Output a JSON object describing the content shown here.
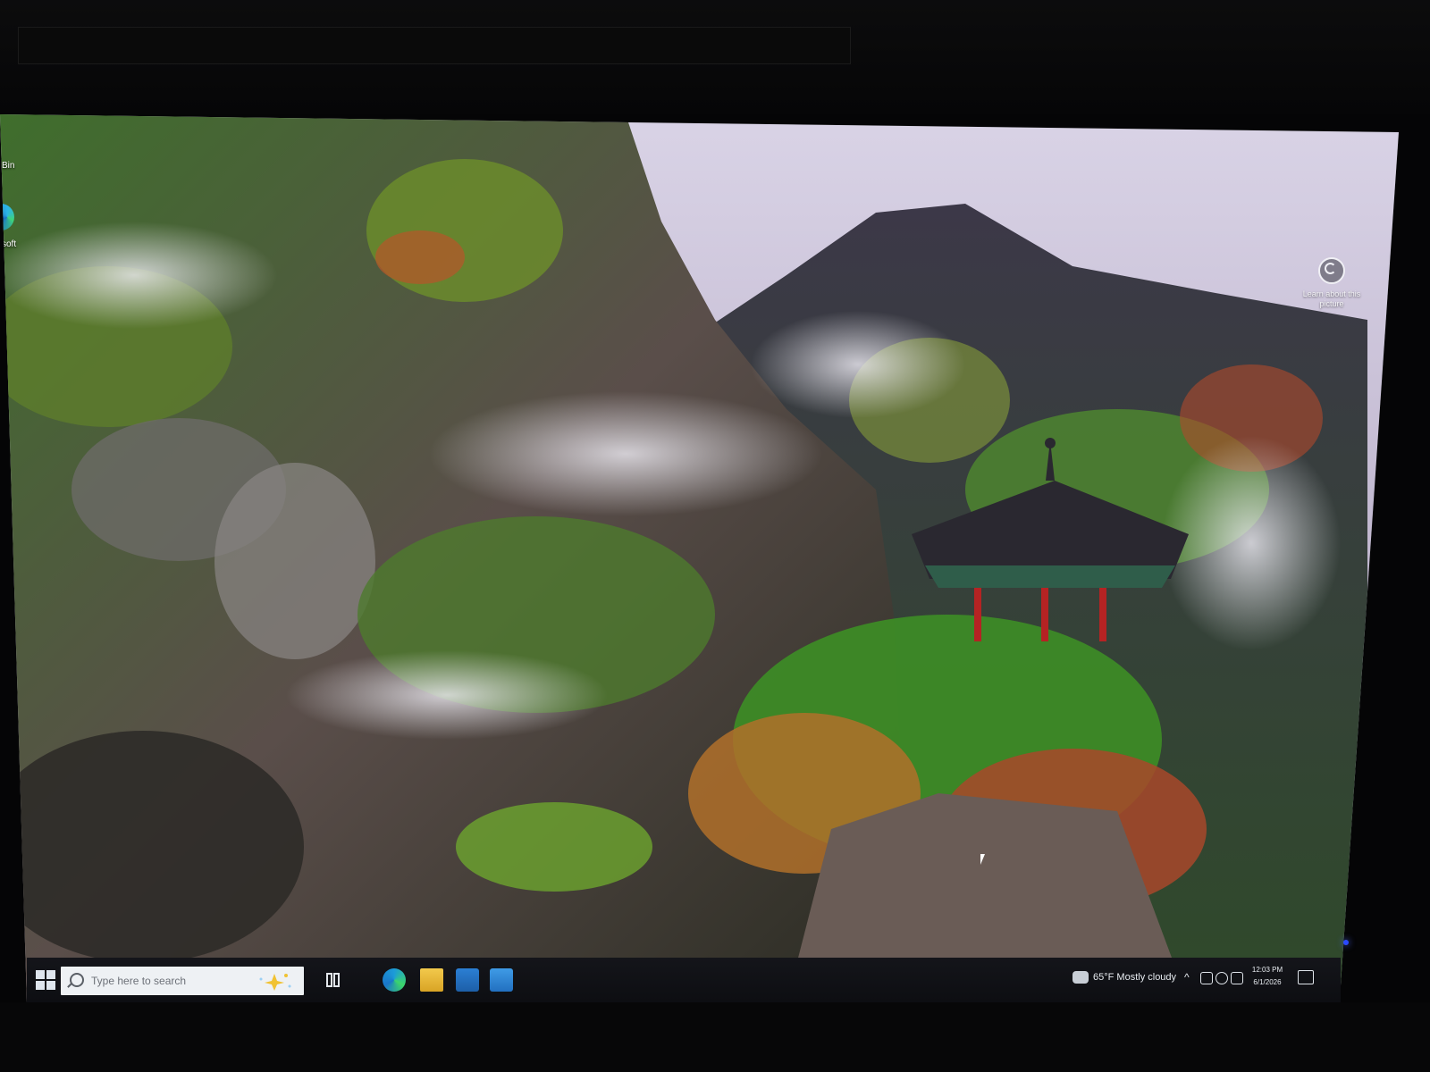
{
  "desktop": {
    "icons": [
      {
        "label": "Bin"
      },
      {
        "label": "soft"
      }
    ],
    "learn_about_picture": "Learn about this picture"
  },
  "taskbar": {
    "search_placeholder": "Type here to search",
    "pinned_apps": [
      "task-view",
      "edge",
      "file-explorer",
      "microsoft-store",
      "mail"
    ],
    "weather": "65°F  Mostly cloudy",
    "clock_time": "12:03 PM",
    "clock_date": "6/1/2026"
  },
  "colors": {
    "taskbar_bg": "#14151a",
    "search_bg": "#eef1f4",
    "power_led": "#2a49ff"
  }
}
